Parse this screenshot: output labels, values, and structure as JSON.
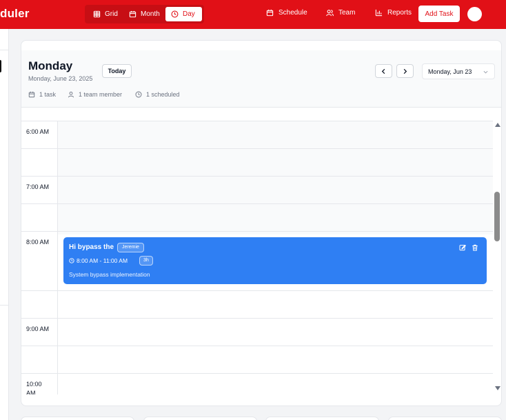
{
  "app": {
    "title": "duler"
  },
  "views": [
    {
      "label": "Grid",
      "icon": "grid-icon",
      "active": false
    },
    {
      "label": "Month",
      "icon": "calendar-icon",
      "active": false
    },
    {
      "label": "Day",
      "icon": "clock-icon",
      "active": true
    }
  ],
  "nav": [
    {
      "label": "Schedule",
      "icon": "calendar-icon"
    },
    {
      "label": "Team",
      "icon": "users-icon"
    },
    {
      "label": "Reports",
      "icon": "bar-chart-icon"
    }
  ],
  "add_task_label": "Add Task",
  "header": {
    "title": "Monday",
    "subtitle": "Monday, June 23, 2025",
    "today_label": "Today",
    "date_select_value": "Monday, Jun 23",
    "stats": {
      "tasks": "1 task",
      "team": "1 team member",
      "scheduled": "1 scheduled"
    }
  },
  "time_slots": [
    "6:00 AM",
    "7:00 AM",
    "8:00 AM",
    "9:00 AM",
    "10:00 AM"
  ],
  "event": {
    "title": "Hi bypass the",
    "assignee": "Jeremie",
    "time": "8:00 AM - 11:00 AM",
    "duration": "3h",
    "description": "System bypass implementation"
  },
  "colors": {
    "brand": "#e11017",
    "event": "#2f7ff3"
  }
}
